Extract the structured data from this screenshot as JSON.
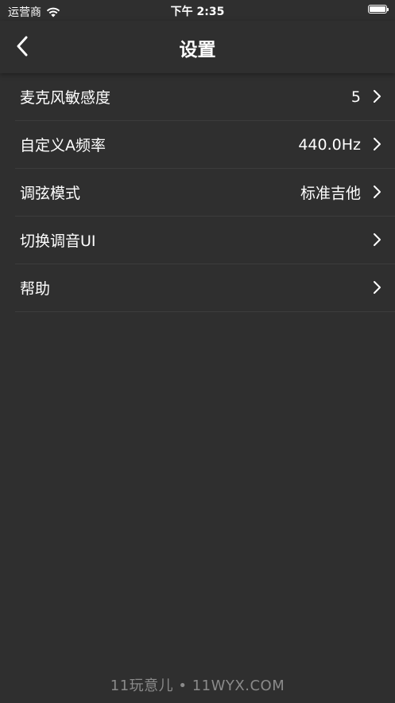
{
  "status_bar": {
    "carrier": "运营商",
    "time": "下午 2:35",
    "wifi_icon": "wifi-icon",
    "battery_icon": "battery-icon"
  },
  "nav": {
    "back_icon": "chevron-left-icon",
    "title": "设置"
  },
  "settings": [
    {
      "label": "麦克风敏感度",
      "value": "5"
    },
    {
      "label": "自定义A频率",
      "value": "440.0Hz"
    },
    {
      "label": "调弦模式",
      "value": "标准吉他"
    },
    {
      "label": "切换调音UI",
      "value": ""
    },
    {
      "label": "帮助",
      "value": ""
    }
  ],
  "watermark": "11玩意儿 • 11WYX.COM",
  "colors": {
    "background": "#2f2f2f",
    "divider": "#3c3c3c",
    "text": "#ffffff",
    "watermark": "#8a8a8a"
  }
}
